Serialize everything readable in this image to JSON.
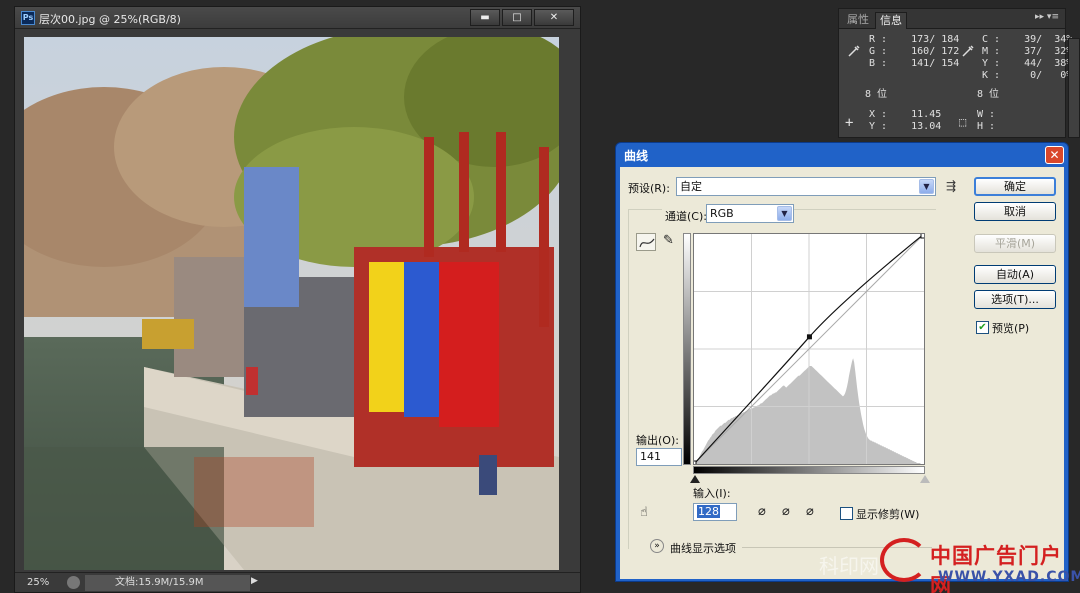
{
  "document": {
    "title": "层次00.jpg @ 25%(RGB/8)",
    "app_icon": "Ps",
    "window_buttons": [
      "▬",
      "□",
      "✕"
    ],
    "zoom": "25%",
    "doc_size": "文档:15.9M/15.9M"
  },
  "info_panel": {
    "tabs": [
      "属性",
      "信息"
    ],
    "active_tab": "信息",
    "rgb": {
      "r": "R :    173/ 184",
      "g": "G :    160/ 172",
      "b": "B :    141/ 154"
    },
    "cmyk": {
      "c": "C :    39/  34%",
      "m": "M :    37/  32%",
      "y": "Y :    44/  38%",
      "k": "K :     0/   0%"
    },
    "bits_left": "8 位",
    "bits_right": "8 位",
    "xy": {
      "x": "X :    11.45",
      "y": "Y :    13.04"
    },
    "wh": {
      "w": "W :",
      "h": "H :"
    }
  },
  "curves_dialog": {
    "title": "曲线",
    "preset_label": "预设(R):",
    "preset_value": "自定",
    "channel_label": "通道(C):",
    "channel_value": "RGB",
    "output_label": "输出(O):",
    "output_value": "141",
    "input_label": "输入(I):",
    "input_value": "128",
    "show_clipping_label": "显示修剪(W)",
    "show_clipping_checked": false,
    "curve_display_options": "曲线显示选项",
    "buttons": {
      "ok": "确定",
      "cancel": "取消",
      "smooth": "平滑(M)",
      "auto": "自动(A)",
      "options": "选项(T)..."
    },
    "preview_label": "预览(P)",
    "preview_checked": true,
    "curve_point": {
      "input": 128,
      "output": 141
    },
    "histogram": [
      0,
      2,
      3,
      4,
      5,
      7,
      9,
      11,
      13,
      14,
      16,
      18,
      20,
      22,
      24,
      25,
      27,
      28,
      30,
      31,
      32,
      34,
      35,
      36,
      37,
      38,
      39,
      39,
      40,
      41,
      42,
      42,
      43,
      44,
      45,
      45,
      46,
      47,
      47,
      48,
      48,
      49,
      49,
      50,
      50,
      51,
      51,
      52,
      52,
      53,
      53,
      54,
      54,
      55,
      55,
      56,
      56,
      57,
      57,
      58,
      58,
      59,
      59,
      60,
      60,
      61,
      62,
      62,
      63,
      64,
      65,
      66,
      67,
      68,
      69,
      70,
      70,
      71,
      72,
      72,
      73,
      73,
      74,
      75,
      76,
      77,
      78,
      79,
      80,
      80,
      79,
      78,
      79,
      80,
      81,
      82,
      83,
      84,
      85,
      86,
      87,
      88,
      89,
      90,
      90,
      91,
      92,
      93,
      94,
      95,
      96,
      97,
      98,
      99,
      100,
      100,
      100,
      99,
      98,
      97,
      96,
      95,
      94,
      93,
      92,
      91,
      90,
      89,
      88,
      87,
      86,
      85,
      84,
      83,
      82,
      81,
      80,
      79,
      78,
      77,
      76,
      75,
      74,
      73,
      72,
      71,
      70,
      69,
      70,
      72,
      75,
      79,
      84,
      90,
      95,
      100,
      105,
      108,
      104,
      96,
      87,
      78,
      70,
      62,
      56,
      50,
      45,
      40,
      36,
      33,
      30,
      28,
      26,
      25,
      24,
      24,
      23,
      23,
      22,
      22,
      21,
      21,
      20,
      20,
      19,
      19,
      18,
      18,
      17,
      17,
      16,
      16,
      15,
      15,
      14,
      14,
      13,
      13,
      12,
      12,
      11,
      11,
      10,
      10,
      9,
      9,
      8,
      8,
      7,
      7,
      6,
      6,
      5,
      5,
      4,
      4,
      3,
      3,
      2,
      2,
      1,
      1,
      1,
      1,
      0,
      0,
      0,
      0
    ]
  },
  "watermark": {
    "left_text": "科印网",
    "brand_cn": "中国广告门户网",
    "url": "WWW.YXAD.COM"
  }
}
